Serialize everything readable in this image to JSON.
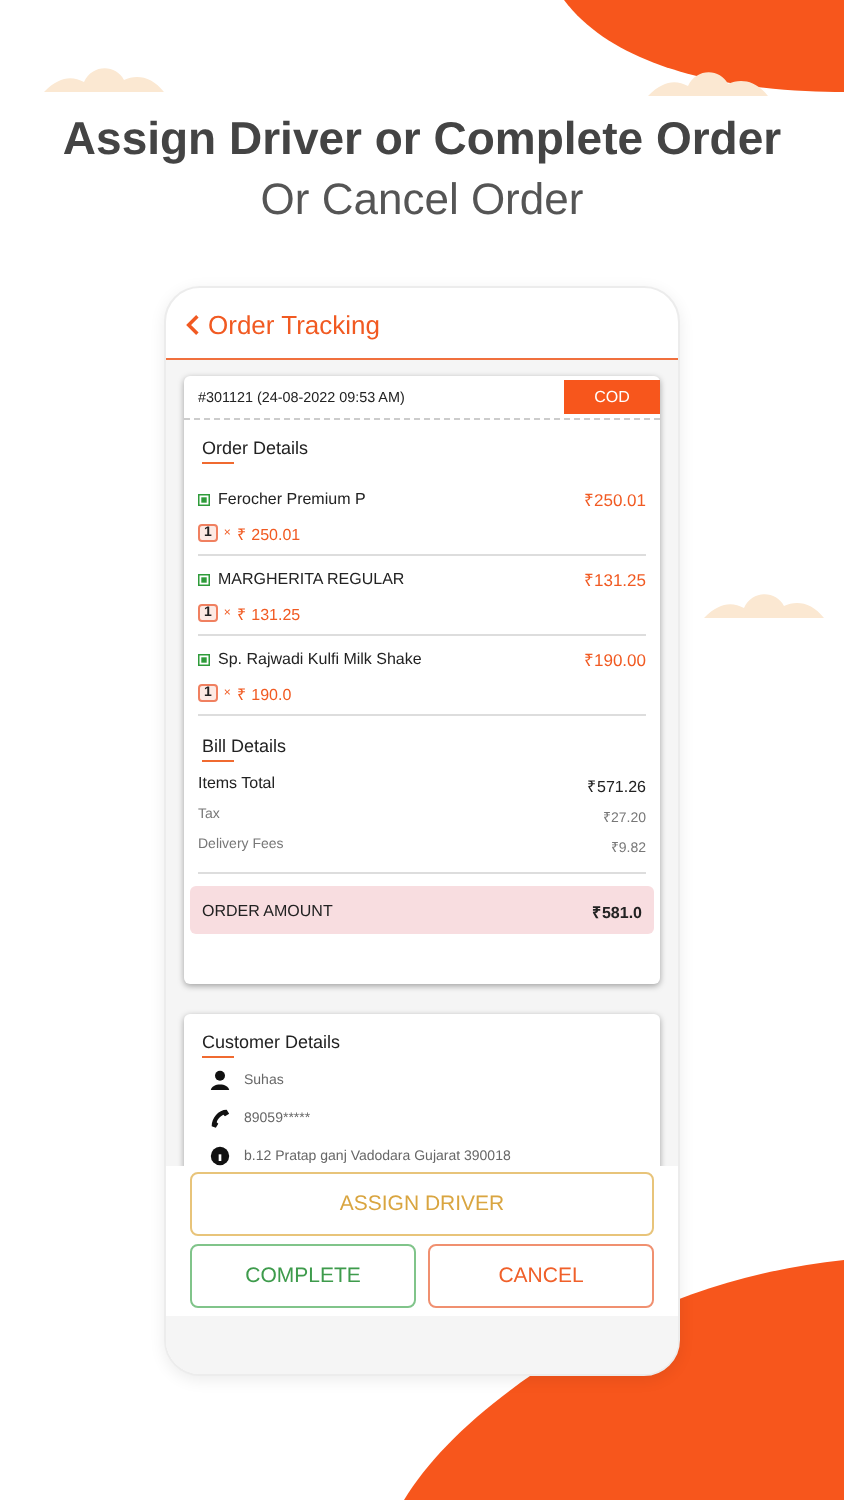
{
  "headline": {
    "title": "Assign Driver or Complete Order",
    "subtitle": "Or Cancel Order"
  },
  "screen": {
    "title": "Order Tracking"
  },
  "order": {
    "number": "#301121 (24-08-2022 09:53 AM)",
    "payment": "COD",
    "section": "Order Details",
    "items": [
      {
        "name": "Ferocher Premium P",
        "qty": "1",
        "multiplier": "×",
        "unit_price": "₹ 250.01",
        "total": "₹250.01"
      },
      {
        "name": "MARGHERITA REGULAR",
        "qty": "1",
        "multiplier": "×",
        "unit_price": "₹ 131.25",
        "total": "₹131.25"
      },
      {
        "name": "Sp. Rajwadi Kulfi Milk Shake",
        "qty": "1",
        "multiplier": "×",
        "unit_price": "₹ 190.0",
        "total": "₹190.00"
      }
    ]
  },
  "bill": {
    "section": "Bill Details",
    "rows": [
      {
        "label": "Items Total",
        "value": "₹571.26",
        "kind": "main"
      },
      {
        "label": "Tax",
        "value": "₹27.20",
        "kind": "minor"
      },
      {
        "label": "Delivery Fees",
        "value": "₹9.82",
        "kind": "minor"
      }
    ],
    "total_label": "ORDER AMOUNT",
    "total_value": "₹581.0"
  },
  "customer": {
    "section": "Customer Details",
    "rows": [
      {
        "kind": "person",
        "text": "Suhas"
      },
      {
        "kind": "phone",
        "text": "89059*****"
      },
      {
        "kind": "location",
        "text": "b.12 Pratap ganj Vadodara Gujarat 390018"
      }
    ]
  },
  "buttons": [
    {
      "label": "ASSIGN DRIVER",
      "kind": "assign"
    },
    {
      "label": "COMPLETE",
      "kind": "complete"
    },
    {
      "label": "CANCEL",
      "kind": "cancel"
    }
  ]
}
